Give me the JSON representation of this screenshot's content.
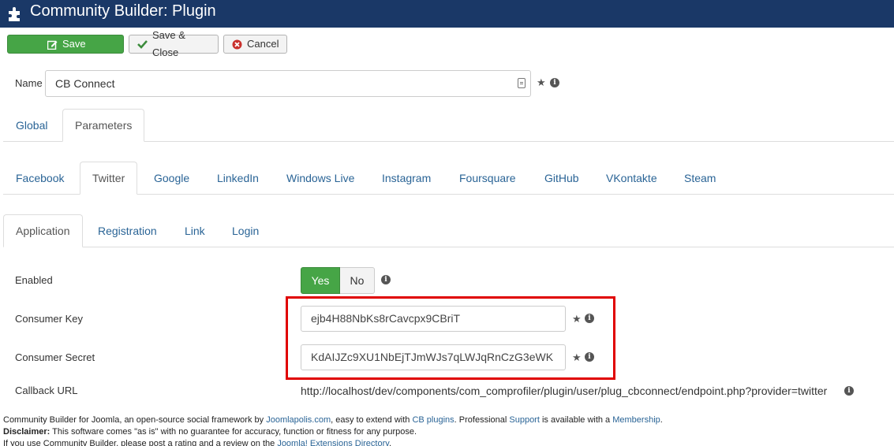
{
  "header": {
    "title": "Community Builder: Plugin"
  },
  "toolbar": {
    "save": "Save",
    "save_close": "Save & Close",
    "cancel": "Cancel"
  },
  "name": {
    "label": "Name",
    "value": "CB Connect"
  },
  "tabs_main": [
    "Global",
    "Parameters"
  ],
  "tabs_providers": [
    "Facebook",
    "Twitter",
    "Google",
    "LinkedIn",
    "Windows Live",
    "Instagram",
    "Foursquare",
    "GitHub",
    "VKontakte",
    "Steam"
  ],
  "tabs_sub": [
    "Application",
    "Registration",
    "Link",
    "Login"
  ],
  "form": {
    "enabled_label": "Enabled",
    "yes": "Yes",
    "no": "No",
    "consumer_key_label": "Consumer Key",
    "consumer_key_value": "ejb4H88NbKs8rCavcpx9CBriT",
    "consumer_secret_label": "Consumer Secret",
    "consumer_secret_value": "KdAIJZc9XU1NbEjTJmWJs7qLWJqRnCzG3eWK",
    "callback_label": "Callback URL",
    "callback_value": "http://localhost/dev/components/com_comprofiler/plugin/user/plug_cbconnect/endpoint.php?provider=twitter"
  },
  "footer": {
    "line1_a": "Community Builder for Joomla, an open-source social framework by ",
    "line1_link1": "Joomlapolis.com",
    "line1_b": ", easy to extend with ",
    "line1_link2": "CB plugins",
    "line1_c": ". Professional ",
    "line1_link3": "Support",
    "line1_d": " is available with a ",
    "line1_link4": "Membership",
    "line1_e": ".",
    "line2_bold": "Disclaimer:",
    "line2_rest": " This software comes \"as is\" with no guarantee for accuracy, function or fitness for any purpose.",
    "line3_a": "If you use Community Builder, please post a rating and a review on the ",
    "line3_link": "Joomla! Extensions Directory",
    "line3_b": "."
  },
  "colors": {
    "header_bg": "#1a3867",
    "success": "#46a546",
    "link": "#2a6496",
    "highlight": "#e00000"
  }
}
